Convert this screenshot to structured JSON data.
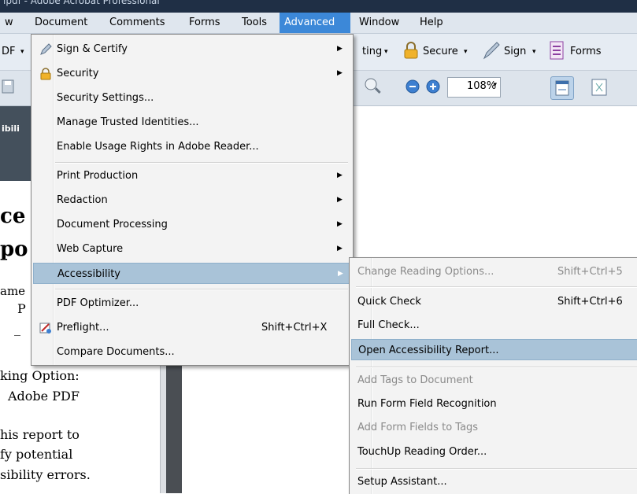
{
  "window": {
    "title": "ipdf - Adobe Acrobat Professional"
  },
  "menubar": {
    "items": [
      {
        "label": "w"
      },
      {
        "label": "Document"
      },
      {
        "label": "Comments"
      },
      {
        "label": "Forms"
      },
      {
        "label": "Tools"
      },
      {
        "label": "Advanced"
      },
      {
        "label": "Window"
      },
      {
        "label": "Help"
      }
    ]
  },
  "toolbar1": {
    "pdf_label": "DF",
    "editing_label": "ting",
    "secure_label": "Secure",
    "sign_label": "Sign",
    "forms_label": "Forms"
  },
  "toolbar2": {
    "zoom": "108%"
  },
  "left_pane": {
    "header": "ibili",
    "lines": [
      "ce",
      "po",
      "ame",
      "P",
      "_",
      "king Option:",
      "Adobe PDF",
      "his report to",
      "fy potential",
      "sibility errors."
    ]
  },
  "advanced_menu": {
    "items": [
      {
        "label": "Sign & Certify",
        "has_submenu": true
      },
      {
        "label": "Security",
        "has_submenu": true
      },
      {
        "label": "Security Settings..."
      },
      {
        "label": "Manage Trusted Identities..."
      },
      {
        "label": "Enable Usage Rights in Adobe Reader..."
      },
      {
        "label": "Print Production",
        "has_submenu": true
      },
      {
        "label": "Redaction",
        "has_submenu": true
      },
      {
        "label": "Document Processing",
        "has_submenu": true
      },
      {
        "label": "Web Capture",
        "has_submenu": true
      },
      {
        "label": "Accessibility",
        "has_submenu": true,
        "highlighted": true
      },
      {
        "label": "PDF Optimizer..."
      },
      {
        "label": "Preflight...",
        "shortcut": "Shift+Ctrl+X"
      },
      {
        "label": "Compare Documents..."
      }
    ]
  },
  "accessibility_submenu": {
    "items": [
      {
        "label": "Change Reading Options...",
        "shortcut": "Shift+Ctrl+5"
      },
      {
        "label": "Quick Check",
        "shortcut": "Shift+Ctrl+6"
      },
      {
        "label": "Full Check..."
      },
      {
        "label": "Open Accessibility Report...",
        "highlighted": true
      },
      {
        "label": "Add Tags to Document",
        "disabled": true
      },
      {
        "label": "Run Form Field Recognition"
      },
      {
        "label": "Add Form Fields to Tags",
        "disabled": true
      },
      {
        "label": "TouchUp Reading Order..."
      },
      {
        "label": "Setup Assistant..."
      }
    ]
  },
  "colors": {
    "highlight": "#a9c3d8",
    "menubar_active": "#3c88d8",
    "menu_bg": "#f3f3f3"
  }
}
